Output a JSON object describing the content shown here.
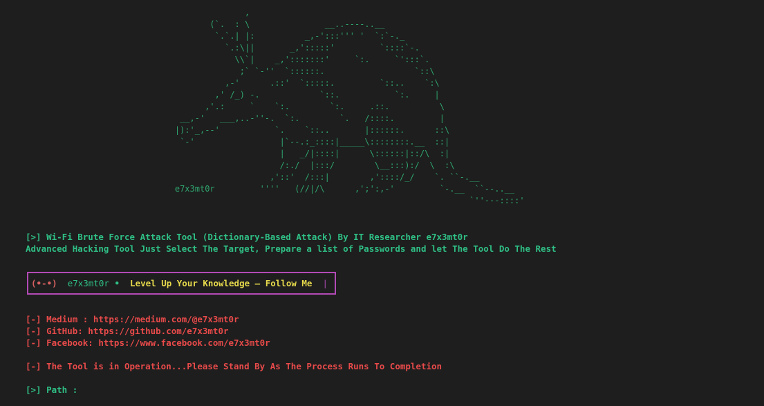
{
  "ascii_art": {
    "tortoise": "                                                 ,\n                                          (`.  : \\               __..----..__\n                                           `.`.| |:          _,-':::''' '  `:`-._\n                                             `.:\\||       _,':::::'         `::::`-.\n                                               \\\\`|    _,':::::::'     `:.     `':::`.\n                                                ;` `-''  `::::::.                  `::\\\n                                             ,-'      .::'  `:::::.         `::..    `:\\\n                                           ,' /_) -.            `::.           `:.     |\n                                         ,'.:     `    `:.        `:.     .::.          \\\n                                    __,-'   ___,..-''-.  `:.        `.   /::::.         |\n                                   |):'_,--'           `.    `::..       |::::::.      ::\\\n                                    `-'                 |`--.:_::::|_____\\::::::::.__  ::|\n                                                        |   _/|::::|      \\::::::|::/\\  :|\n                                                        /:./  |:::/        \\__:::):/  \\  :\\\n                                                      ,'::'  /:::|        ,'::::/_/    `. ``-.__\n                                   e7x3mt0r         ''''   (//|/\\      ,';':,-'         `-.__  ``--..__\n                                                                                              `''---::::'"
  },
  "header": {
    "title_line": "[>] Wi-Fi Brute Force Attack Tool (Dictionary-Based Attack) By IT Researcher e7x3mt0r",
    "subtitle_line": "Advanced Hacking Tool Just Select The Target, Prepare a list of Passwords and let The Tool Do The Rest"
  },
  "banner": {
    "face": "(•-•)",
    "author": "e7x3mt0r",
    "dot": "•",
    "message": "Level Up Your Knowledge — Follow Me",
    "pipe": "|"
  },
  "links": [
    {
      "label": "[-] Medium : https://medium.com/@e7x3mt0r"
    },
    {
      "label": "[-] GitHub: https://github.com/e7x3mt0r"
    },
    {
      "label": "[-] Facebook: https://www.facebook.com/e7x3mt0r"
    }
  ],
  "status": {
    "operation_line": "[-] The Tool is in Operation...Please Stand By As The Process Runs To Completion"
  },
  "prompt": {
    "path_line": "[>] Path :"
  },
  "colors": {
    "background": "#1e1e1e",
    "green": "#2fbf85",
    "red": "#e84a4a",
    "yellow": "#e6d94c",
    "magenta": "#b24ab6"
  }
}
